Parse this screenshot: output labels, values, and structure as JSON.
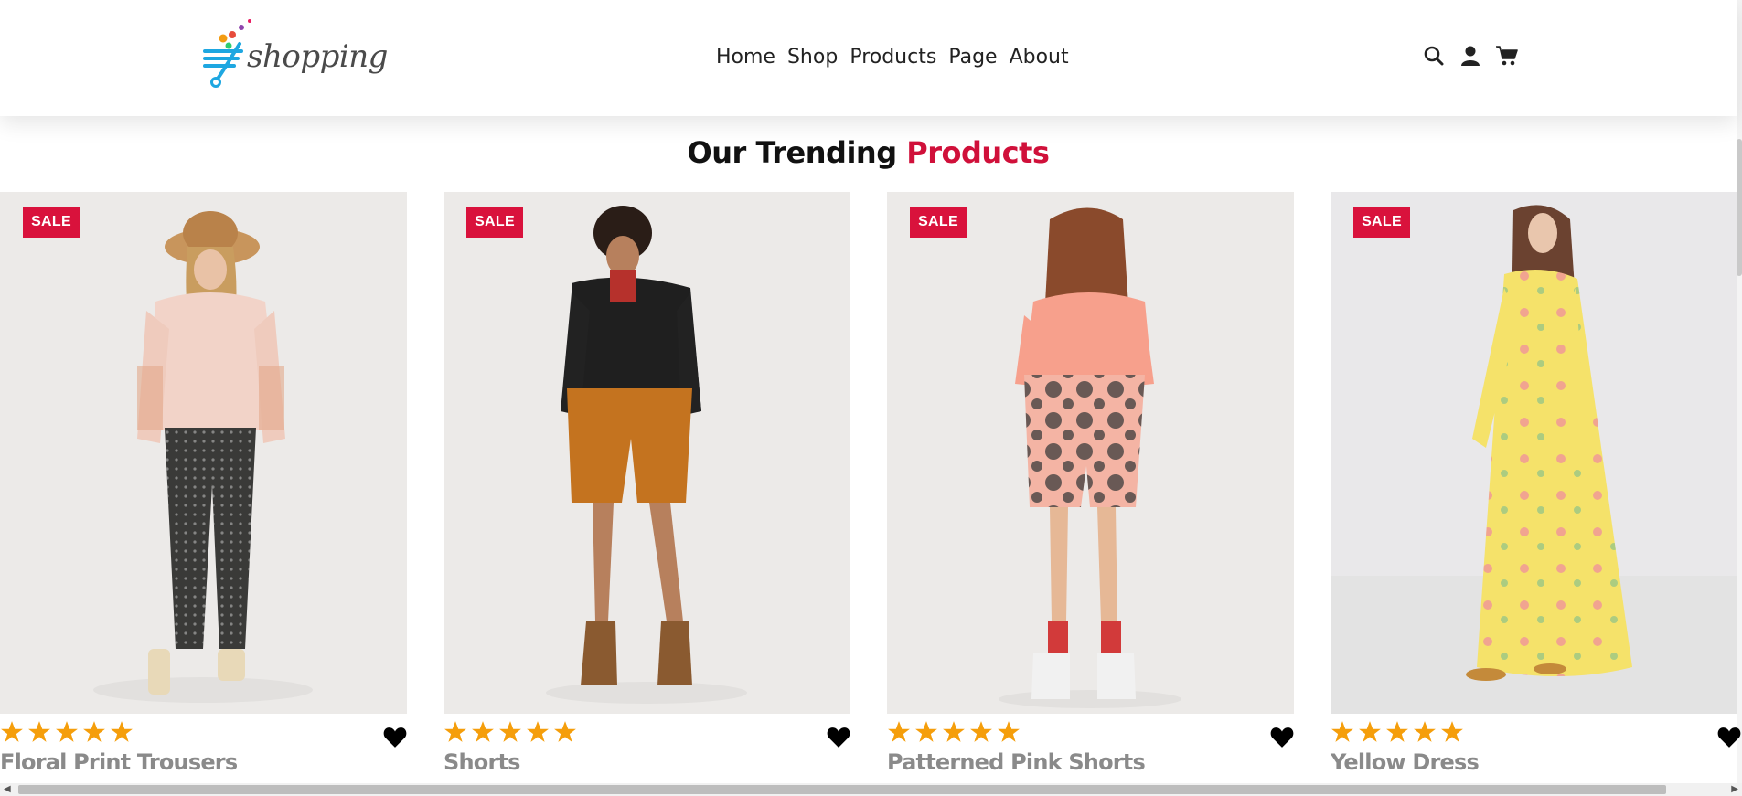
{
  "brand": {
    "logo_text": "shopping"
  },
  "nav": {
    "items": [
      "Home",
      "Shop",
      "Products",
      "Page",
      "About"
    ]
  },
  "header_icons": [
    "search-icon",
    "user-icon",
    "cart-icon"
  ],
  "section": {
    "title_main": "Our Trending",
    "title_accent": "Products"
  },
  "products": [
    {
      "name": "Floral Print Trousers",
      "badge": "SALE",
      "rating": 5
    },
    {
      "name": "Shorts",
      "badge": "SALE",
      "rating": 5
    },
    {
      "name": "Patterned Pink Shorts",
      "badge": "SALE",
      "rating": 5
    },
    {
      "name": "Yellow Dress",
      "badge": "SALE",
      "rating": 5
    }
  ],
  "colors": {
    "accent": "#d0103a",
    "sale_badge": "#d9123c",
    "star": "#f59e0b",
    "image_bg": "#eceae8"
  }
}
